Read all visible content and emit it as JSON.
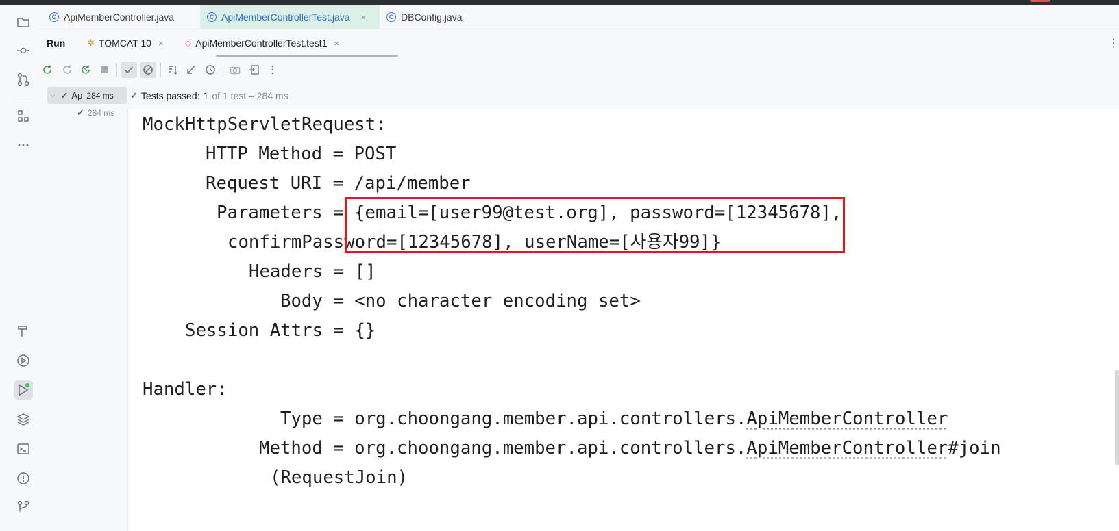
{
  "editor_tabs": [
    {
      "label": "ApiMemberController.java",
      "icon": "class-icon",
      "active": false
    },
    {
      "label": "ApiMemberControllerTest.java",
      "icon": "test-class-icon",
      "active": true,
      "close": "×"
    },
    {
      "label": "DBConfig.java",
      "icon": "class-icon",
      "active": false
    }
  ],
  "run_panel": {
    "title": "Run",
    "tabs": [
      {
        "label": "TOMCAT 10",
        "icon": "tomcat-icon",
        "close": "×"
      },
      {
        "label": "ApiMemberControllerTest.test1",
        "icon": "junit-icon",
        "close": "×"
      }
    ],
    "more": "⋮"
  },
  "test_tree": {
    "root_label": "Ap",
    "root_time": "284 ms",
    "child_time": "284 ms"
  },
  "status": {
    "label": "Tests passed:",
    "passed": "1",
    "rest": "of 1 test – 284 ms"
  },
  "console": {
    "l1": "MockHttpServletRequest:",
    "l2": "HTTP Method = POST",
    "l3": "Request URI = /api/member",
    "l4": "Parameters = {email=[user99@test.org], password=[12345678],",
    "l5": "confirmPassword=[12345678], userName=[사용자99]}",
    "l6": "Headers = []",
    "l7": "Body = <no character encoding set>",
    "l8": "Session Attrs = {}",
    "l9": "Handler:",
    "l10_pre": "Type = org.choongang.member.api.controllers.",
    "l10_link": "ApiMemberController",
    "l11_pre": "Method = org.choongang.member.api.controllers.",
    "l11_link": "ApiMemberController",
    "l11_post": "#join",
    "l12": "(RequestJoin)"
  },
  "colors": {
    "highlight_box": "#e3171c",
    "pass_green": "#208a3c",
    "active_tab_bg": "#dcf0e8"
  }
}
